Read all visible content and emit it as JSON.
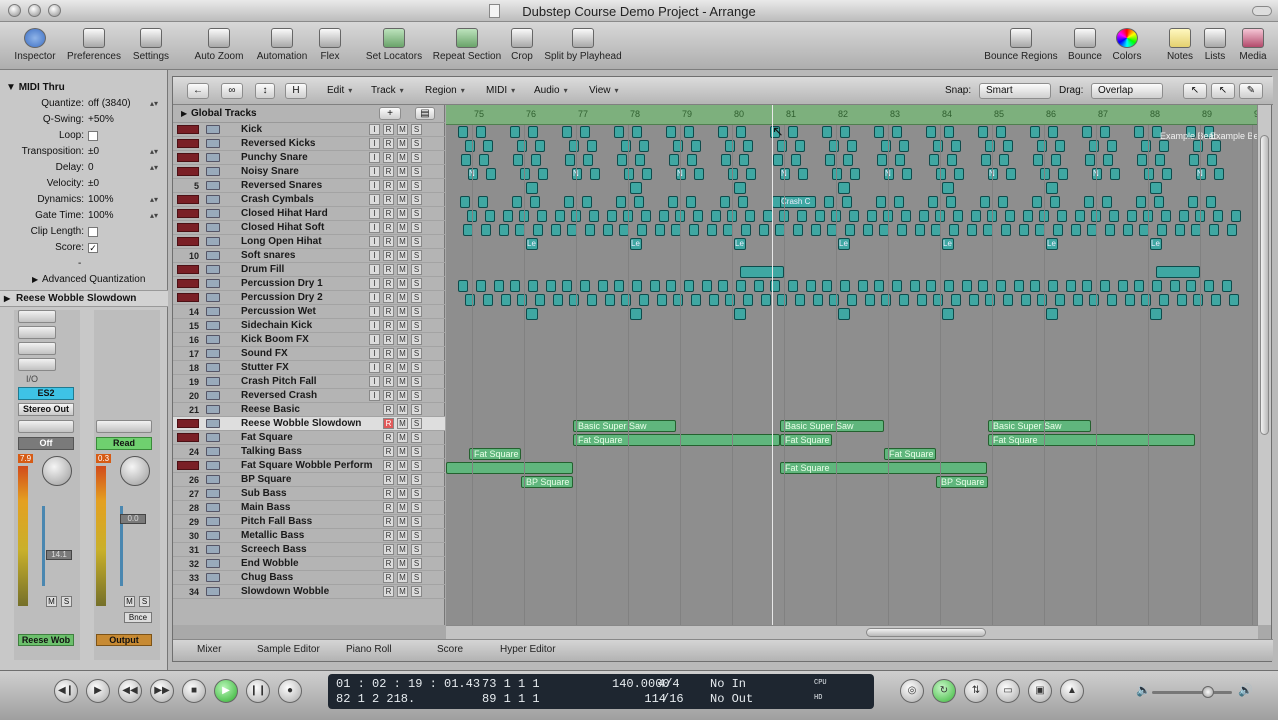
{
  "window": {
    "title": "Dubstep Course Demo Project - Arrange"
  },
  "toolbar": {
    "inspector": "Inspector",
    "preferences": "Preferences",
    "settings": "Settings",
    "auto_zoom": "Auto Zoom",
    "automation": "Automation",
    "flex": "Flex",
    "set_locators": "Set Locators",
    "repeat_section": "Repeat Section",
    "crop": "Crop",
    "split_by_playhead": "Split by Playhead",
    "bounce_regions": "Bounce Regions",
    "bounce": "Bounce",
    "colors": "Colors",
    "notes": "Notes",
    "lists": "Lists",
    "media": "Media"
  },
  "inspector": {
    "header": "MIDI Thru",
    "params": [
      {
        "label": "Quantize:",
        "value": "off (3840)",
        "arrow": true
      },
      {
        "label": "Q-Swing:",
        "value": "+50%"
      },
      {
        "label": "Loop:",
        "checkbox": true,
        "checked": false
      },
      {
        "label": "Transposition:",
        "value": "±0",
        "arrow": true
      },
      {
        "label": "Delay:",
        "value": "0",
        "arrow": true
      },
      {
        "label": "Velocity:",
        "value": "±0"
      },
      {
        "label": "Dynamics:",
        "value": "100%",
        "arrow": true
      },
      {
        "label": "Gate Time:",
        "value": "100%",
        "arrow": true
      },
      {
        "label": "Clip Length:",
        "checkbox": true,
        "checked": false
      },
      {
        "label": "Score:",
        "checkbox": true,
        "checked": true
      }
    ],
    "dash": "-",
    "advanced": "Advanced Quantization",
    "region_name": "Reese Wobble Slowdown",
    "io_label": "I/O",
    "plugin": "ES2",
    "output": "Stereo Out",
    "auto_mode_left": "Off",
    "auto_mode_right": "Read",
    "left_level": "7.9",
    "right_level": "0.3",
    "left_fader": "14.1",
    "right_fader": "0.0",
    "m": "M",
    "s": "S",
    "bnce": "Bnce",
    "left_name": "Reese Wob",
    "right_name": "Output"
  },
  "localbar": {
    "edit": "Edit",
    "track": "Track",
    "region": "Region",
    "midi": "MIDI",
    "audio": "Audio",
    "view": "View",
    "snap_label": "Snap:",
    "snap": "Smart",
    "drag_label": "Drag:",
    "drag": "Overlap",
    "h": "H"
  },
  "global_tracks": "Global Tracks",
  "tracks": [
    {
      "n": "",
      "name": "Kick"
    },
    {
      "n": "",
      "name": "Reversed Kicks"
    },
    {
      "n": "",
      "name": "Punchy Snare"
    },
    {
      "n": "",
      "name": "Noisy Snare"
    },
    {
      "n": "5",
      "name": "Reversed Snares"
    },
    {
      "n": "",
      "name": "Crash Cymbals"
    },
    {
      "n": "",
      "name": "Closed Hihat Hard"
    },
    {
      "n": "",
      "name": "Closed Hihat Soft"
    },
    {
      "n": "",
      "name": "Long Open Hihat"
    },
    {
      "n": "10",
      "name": "Soft snares"
    },
    {
      "n": "",
      "name": "Drum Fill"
    },
    {
      "n": "",
      "name": "Percussion Dry 1"
    },
    {
      "n": "",
      "name": "Percussion Dry 2"
    },
    {
      "n": "14",
      "name": "Percussion Wet"
    },
    {
      "n": "15",
      "name": "Sidechain Kick"
    },
    {
      "n": "16",
      "name": "Kick Boom FX"
    },
    {
      "n": "17",
      "name": "Sound FX"
    },
    {
      "n": "18",
      "name": "Stutter FX"
    },
    {
      "n": "19",
      "name": "Crash Pitch Fall"
    },
    {
      "n": "20",
      "name": "Reversed Crash"
    },
    {
      "n": "21",
      "name": "Reese Basic"
    },
    {
      "n": "",
      "name": "Reese Wobble Slowdown"
    },
    {
      "n": "",
      "name": "Fat Square"
    },
    {
      "n": "24",
      "name": "Talking Bass"
    },
    {
      "n": "",
      "name": "Fat Square Wobble Perform"
    },
    {
      "n": "26",
      "name": "BP Square"
    },
    {
      "n": "27",
      "name": "Sub Bass"
    },
    {
      "n": "28",
      "name": "Main Bass"
    },
    {
      "n": "29",
      "name": "Pitch Fall Bass"
    },
    {
      "n": "30",
      "name": "Metallic Bass"
    },
    {
      "n": "31",
      "name": "Screech Bass"
    },
    {
      "n": "32",
      "name": "End Wobble"
    },
    {
      "n": "33",
      "name": "Chug Bass"
    },
    {
      "n": "34",
      "name": "Slowdown Wobble"
    }
  ],
  "ruler": {
    "bars": [
      "75",
      "76",
      "77",
      "78",
      "79",
      "80",
      "81",
      "82",
      "83",
      "84",
      "85",
      "86",
      "87",
      "88",
      "89",
      "90"
    ],
    "marker": "Example Beat"
  },
  "regions": {
    "crash": "Crash C",
    "basic_super_saw": "Basic Super Saw",
    "fat_square": "Fat Square",
    "bp_square": "BP Square",
    "le": "Le",
    "n": "N",
    "c": "C"
  },
  "editor_tabs": {
    "mixer": "Mixer",
    "sample_editor": "Sample Editor",
    "piano_roll": "Piano Roll",
    "score": "Score",
    "hyper_editor": "Hyper Editor"
  },
  "transport": {
    "smpte": "01 : 02 : 19 : 01.43",
    "smpte2": "82   1   2  218.",
    "bars1": "73   1   1       1",
    "bars2": "89   1   1       1",
    "tempo": "140.0000",
    "tempo2": "114",
    "sig": "4/4",
    "div": "/16",
    "in": "No In",
    "out": "No Out",
    "cpu": "CPU",
    "hd": "HD"
  }
}
